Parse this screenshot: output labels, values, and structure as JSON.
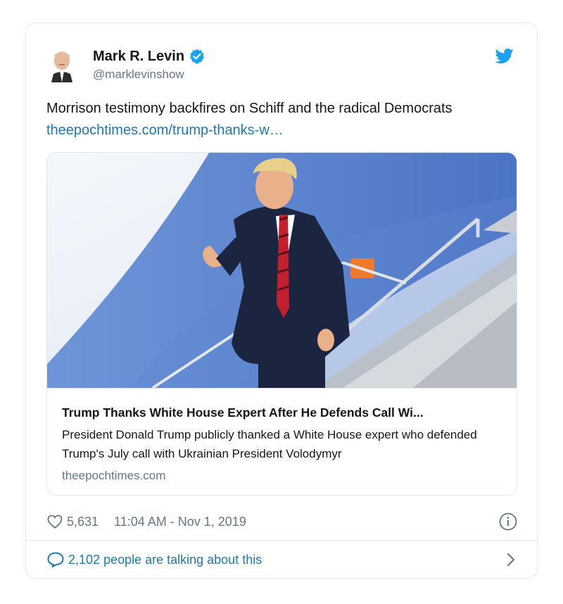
{
  "author": {
    "name": "Mark R. Levin",
    "handle": "@marklevinshow",
    "verified": true
  },
  "tweet": {
    "text": "Morrison testimony backfires on Schiff and the radical Democrats",
    "link_text": "theepochtimes.com/trump-thanks-w…"
  },
  "card": {
    "title": "Trump Thanks White House Expert After He Defends Call Wi...",
    "description": "President Donald Trump publicly thanked a White House expert who defended Trump's July call with Ukrainian President Volodymyr",
    "domain": "theepochtimes.com"
  },
  "stats": {
    "likes": "5,631",
    "timestamp": "11:04 AM - Nov 1, 2019"
  },
  "conversation": {
    "text": "2,102 people are talking about this"
  },
  "colors": {
    "link": "#1b7ab5",
    "twitter_blue": "#1da1f2",
    "muted": "#657786",
    "border": "#e1e8ed"
  },
  "icons": [
    "avatar",
    "verified-badge-icon",
    "twitter-bird-icon",
    "heart-icon",
    "info-icon",
    "speech-bubble-icon",
    "chevron-right-icon"
  ]
}
